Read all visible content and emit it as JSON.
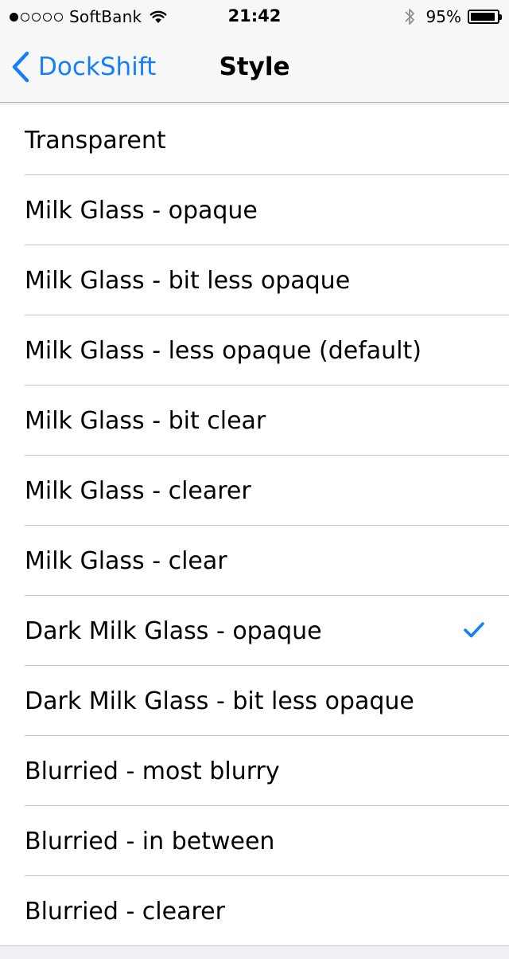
{
  "status_bar": {
    "signal_filled": 1,
    "signal_total": 5,
    "carrier": "SoftBank",
    "time": "21:42",
    "battery_percent": "95%",
    "battery_level": 0.95
  },
  "nav": {
    "back_label": "DockShift",
    "title": "Style"
  },
  "options": [
    {
      "label": "Transparent",
      "selected": false
    },
    {
      "label": "Milk Glass - opaque",
      "selected": false
    },
    {
      "label": "Milk Glass - bit less opaque",
      "selected": false
    },
    {
      "label": "Milk Glass - less opaque (default)",
      "selected": false
    },
    {
      "label": "Milk Glass - bit clear",
      "selected": false
    },
    {
      "label": "Milk Glass - clearer",
      "selected": false
    },
    {
      "label": "Milk Glass - clear",
      "selected": false
    },
    {
      "label": "Dark Milk Glass - opaque",
      "selected": true
    },
    {
      "label": "Dark Milk Glass - bit less opaque",
      "selected": false
    },
    {
      "label": "Blurried - most blurry",
      "selected": false
    },
    {
      "label": "Blurried - in between",
      "selected": false
    },
    {
      "label": "Blurried - clearer",
      "selected": false
    }
  ],
  "colors": {
    "accent": "#157efb",
    "background": "#efeff4",
    "separator": "#c8c7cc"
  },
  "icons": {
    "back": "chevron-left-icon",
    "wifi": "wifi-icon",
    "bluetooth": "bluetooth-icon",
    "battery": "battery-icon",
    "check": "checkmark-icon"
  }
}
